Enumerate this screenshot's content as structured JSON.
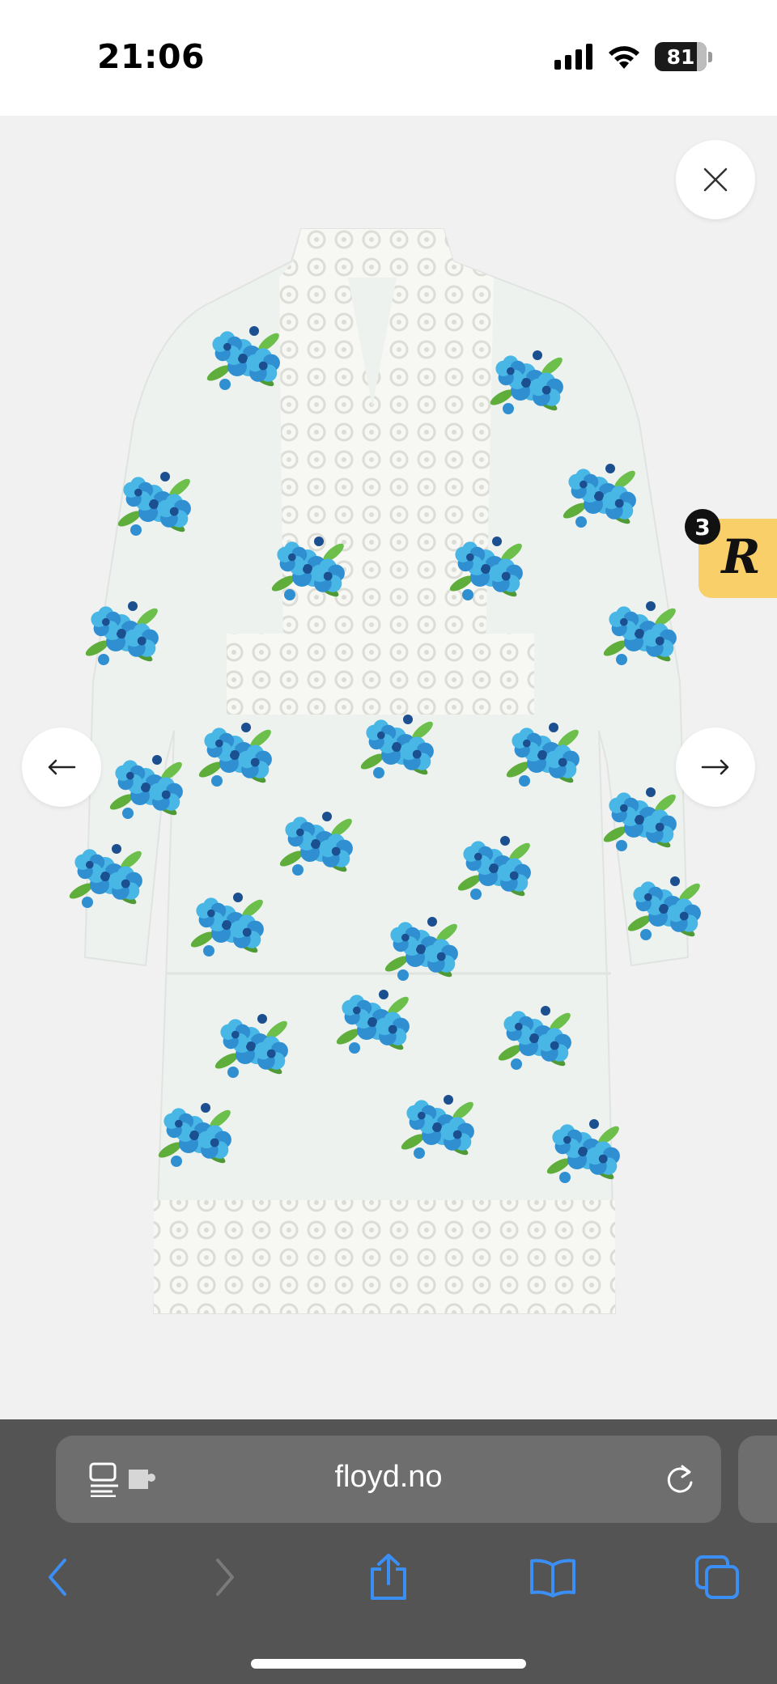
{
  "status_bar": {
    "time": "21:06",
    "battery": "81"
  },
  "product_viewer": {
    "image_icon": "floral-dress-image",
    "colors": {
      "background": "#f1f1f1",
      "fabric": "#eef2ef",
      "flower_blue": "#2f8fd1",
      "flower_light": "#49b7e6",
      "leaf_green": "#5fae3c",
      "lace": "#f7f7f4"
    },
    "close_icon": "close-icon",
    "prev_icon": "arrow-left-icon",
    "next_icon": "arrow-right-icon"
  },
  "reviews_widget": {
    "count": "3",
    "logo": "R",
    "color": "#f9cf6a"
  },
  "browser": {
    "url": "floyd.no",
    "icons": [
      "reader-icon",
      "extension-icon",
      "reload-icon",
      "back-icon",
      "forward-icon",
      "share-icon",
      "bookmarks-icon",
      "tabs-icon"
    ],
    "accent": "#3b8ef3"
  }
}
